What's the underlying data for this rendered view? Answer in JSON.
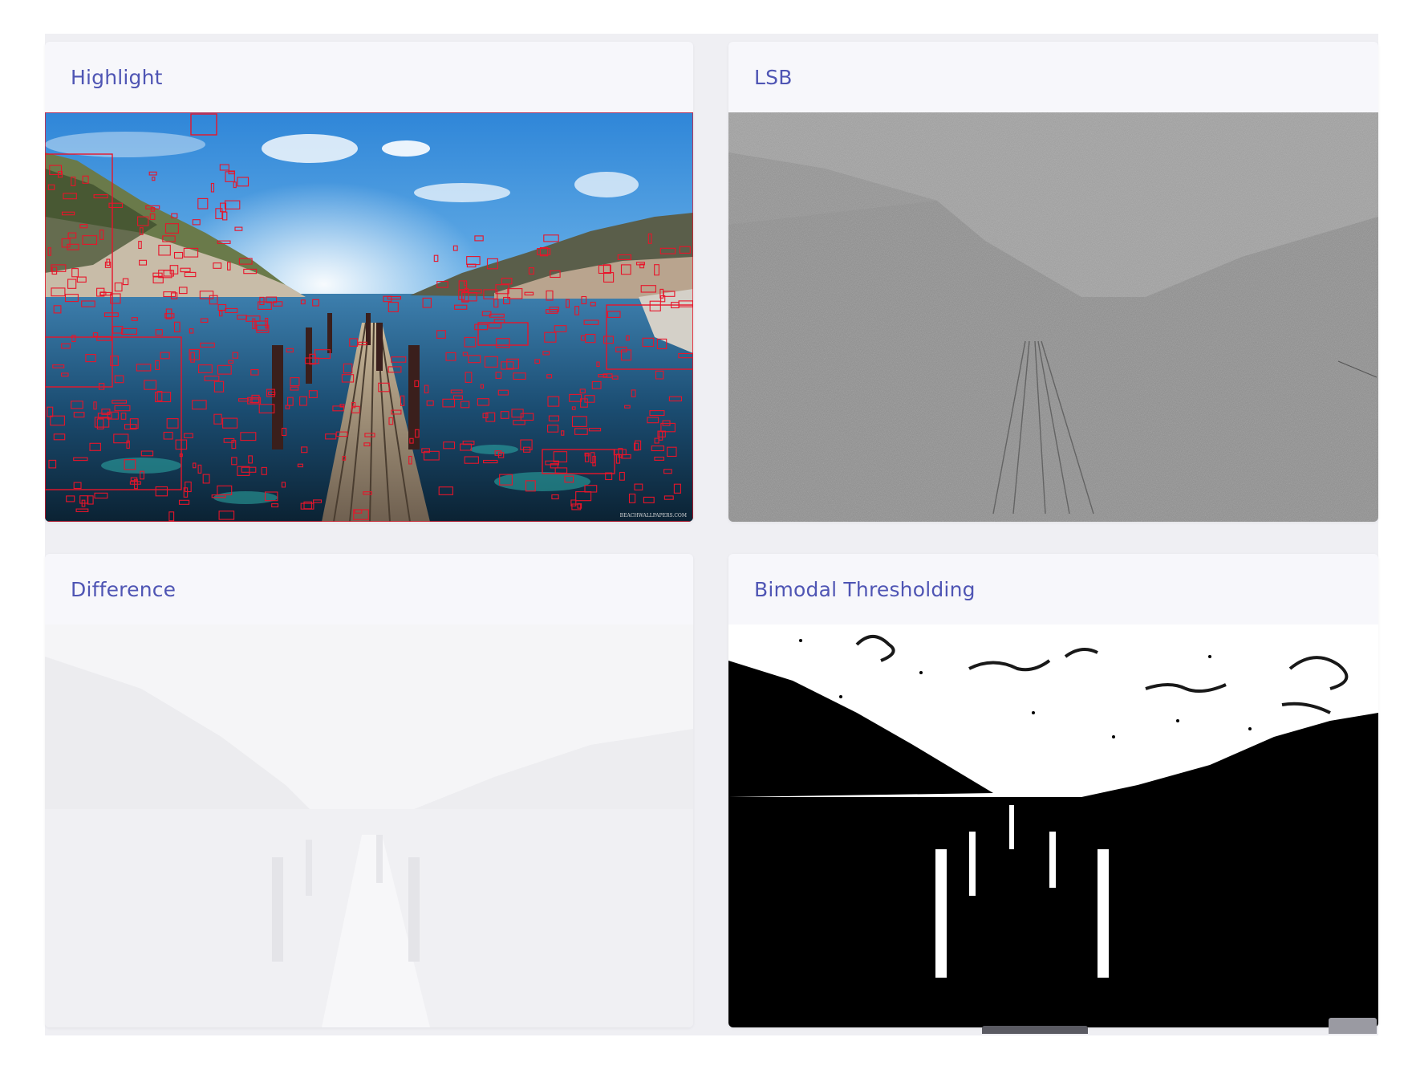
{
  "panels": [
    {
      "title": "Highlight",
      "image": "pier-highlight-red-boxes-image",
      "watermark": "BEACHWALLPAPERS.COM"
    },
    {
      "title": "LSB",
      "image": "lsb-noise-grayscale-image"
    },
    {
      "title": "Difference",
      "image": "difference-faded-white-image"
    },
    {
      "title": "Bimodal Thresholding",
      "image": "bimodal-threshold-black-white-image"
    }
  ],
  "colors": {
    "title": "#4f55b4",
    "highlight_box": "#e8142a",
    "board": "#efeff3",
    "card": "#f6f6fa"
  }
}
